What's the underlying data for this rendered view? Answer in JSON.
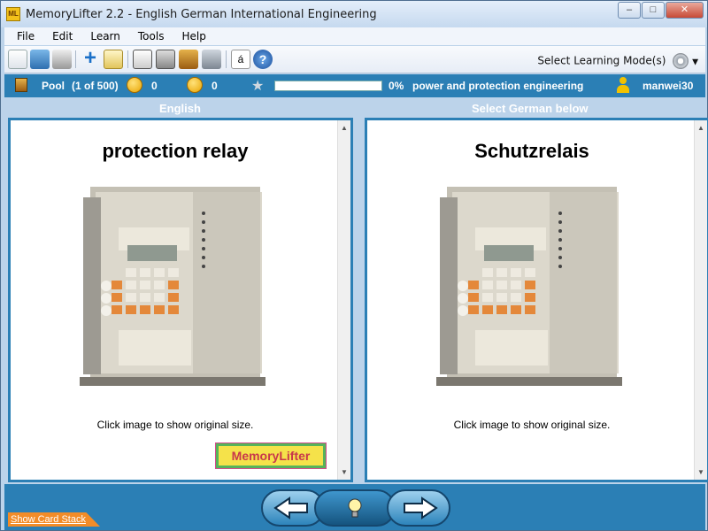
{
  "window": {
    "title": "MemoryLifter 2.2 - English German International Engineering",
    "app_icon_text": "ML"
  },
  "menu": [
    "File",
    "Edit",
    "Learn",
    "Tools",
    "Help"
  ],
  "toolbar": {
    "learning_mode_label": "Select Learning Mode(s)"
  },
  "status": {
    "pool_label": "Pool",
    "pool_count": "(1 of 500)",
    "correct_count": "0",
    "wrong_count": "0",
    "progress_percent": "0%",
    "progress_value": 0,
    "chapter": "power and protection engineering",
    "user": "manwei30"
  },
  "left_pane": {
    "header": "English",
    "word": "protection relay",
    "caption": "Click image to show original size.",
    "logo_text": "MemoryLifter"
  },
  "right_pane": {
    "header": "Select German below",
    "word": "Schutzrelais",
    "caption": "Click image to show original size."
  },
  "footer": {
    "show_card_stack": "Show Card Stack"
  },
  "colors": {
    "frame_blue": "#2b7fb5",
    "window_chrome": "#bcd3ea",
    "logo_yellow": "#f5e24a"
  }
}
